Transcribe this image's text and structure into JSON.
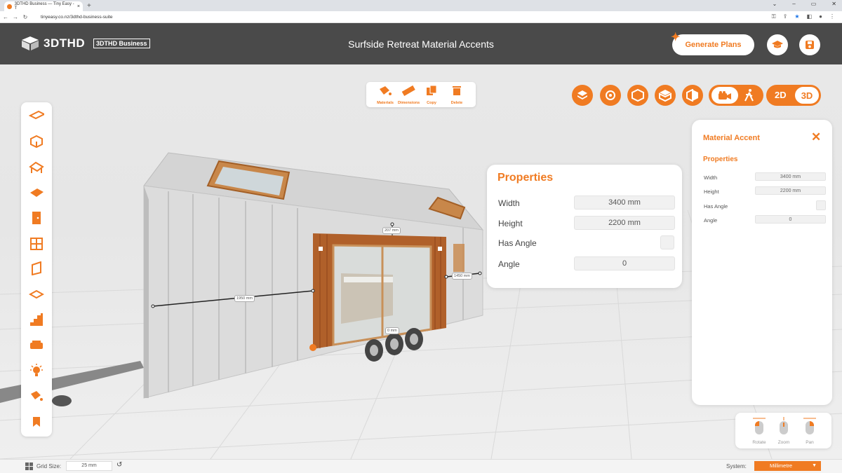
{
  "browser": {
    "tab_title": "3DTHD Business — Tiny Easy - T",
    "new_tab": "+",
    "url": "tinyeasy.co.nz/3dthd-business-suite",
    "win_min": "⌄",
    "win_min2": "–",
    "win_max": "▭",
    "win_close": "✕"
  },
  "header": {
    "logo": "3DTHD",
    "badge": "3DTHD Business",
    "title": "Surfside Retreat Material Accents",
    "generate_plans": "Generate Plans"
  },
  "top_tools": [
    {
      "label": "Materials",
      "icon": "paint-bucket-icon"
    },
    {
      "label": "Dimensions",
      "icon": "ruler-icon"
    },
    {
      "label": "Copy",
      "icon": "copy-icon"
    },
    {
      "label": "Delete",
      "icon": "trash-icon"
    }
  ],
  "view_toggle": {
    "two_d": "2D",
    "three_d": "3D"
  },
  "dimensions": {
    "top": "207 mm",
    "left": "1950 mm",
    "right": "1450 mm",
    "bottom": "0 mm"
  },
  "properties_card": {
    "title": "Properties",
    "rows": [
      {
        "label": "Width",
        "value": "3400 mm"
      },
      {
        "label": "Height",
        "value": "2200 mm"
      },
      {
        "label": "Has Angle",
        "value": ""
      },
      {
        "label": "Angle",
        "value": "0"
      }
    ]
  },
  "side_panel": {
    "title": "Material Accent",
    "close": "✕",
    "subtitle": "Properties",
    "rows": [
      {
        "label": "Width",
        "value": "3400 mm"
      },
      {
        "label": "Height",
        "value": "2200 mm"
      },
      {
        "label": "Has Angle",
        "value": ""
      },
      {
        "label": "Angle",
        "value": "0"
      }
    ]
  },
  "mouse_help": [
    {
      "label": "Rotate"
    },
    {
      "label": "Zoom"
    },
    {
      "label": "Pan"
    }
  ],
  "status": {
    "grid_label": "Grid Size:",
    "grid_value": "25 mm",
    "system_label": "System:",
    "system_value": "Millimetre"
  },
  "colors": {
    "accent": "#f07b22",
    "header": "#4a4a4a"
  }
}
